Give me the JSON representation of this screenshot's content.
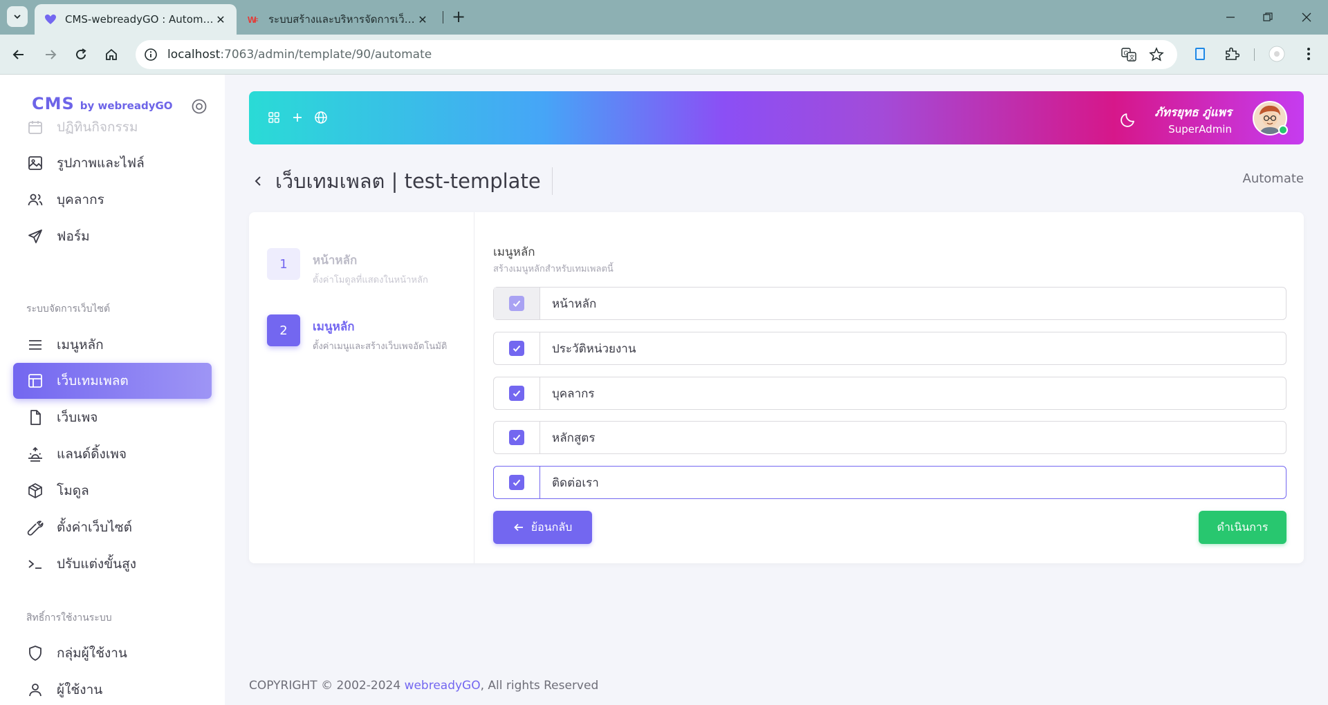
{
  "browser": {
    "tabs": [
      {
        "title": "CMS-webreadyGO : Automate",
        "active": true,
        "favicon": "heart-icon"
      },
      {
        "title": "ระบบสร้างและบริหารจัดการเว็บไซต์",
        "active": false,
        "favicon": "wf-logo-icon"
      }
    ],
    "url_host": "localhost",
    "url_path": ":7063/admin/template/90/automate"
  },
  "brand": {
    "name": "CMS",
    "by": "by webreadyGO"
  },
  "sidebar": {
    "top_items": [
      {
        "label": "ปฏิทินกิจกรรม",
        "icon": "calendar-icon"
      },
      {
        "label": "รูปภาพและไฟล์",
        "icon": "image-icon"
      },
      {
        "label": "บุคลากร",
        "icon": "users-icon"
      },
      {
        "label": "ฟอร์ม",
        "icon": "send-icon"
      }
    ],
    "section_site": "ระบบจัดการเว็บไซต์",
    "site_items": [
      {
        "label": "เมนูหลัก",
        "icon": "menu-icon"
      },
      {
        "label": "เว็บเทมเพลต",
        "icon": "layout-icon"
      },
      {
        "label": "เว็บเพจ",
        "icon": "file-icon"
      },
      {
        "label": "แลนด์ดิ้งเพจ",
        "icon": "sunrise-icon"
      },
      {
        "label": "โมดูล",
        "icon": "box-icon"
      },
      {
        "label": "ตั้งค่าเว็บไซต์",
        "icon": "wrench-icon"
      },
      {
        "label": "ปรับแต่งขั้นสูง",
        "icon": "terminal-icon"
      }
    ],
    "section_access": "สิทธิ์การใช้งานระบบ",
    "access_items": [
      {
        "label": "กลุ่มผู้ใช้งาน",
        "icon": "shield-icon"
      },
      {
        "label": "ผู้ใช้งาน",
        "icon": "user-icon"
      }
    ]
  },
  "header": {
    "user_name": "ภัทรยุทธ ภู่แพร",
    "user_role": "SuperAdmin"
  },
  "page": {
    "title": "เว็บเทมเพลต | test-template",
    "breadcrumb": "Automate"
  },
  "steps": [
    {
      "number": "1",
      "title": "หน้าหลัก",
      "subtitle": "ตั้งค่าโมดูลที่แสดงในหน้าหลัก",
      "state": "done"
    },
    {
      "number": "2",
      "title": "เมนูหลัก",
      "subtitle": "ตั้งค่าเมนูและสร้างเว็บเพจอัตโนมัติ",
      "state": "current"
    }
  ],
  "form": {
    "title": "เมนูหลัก",
    "subtitle": "สร้างเมนูหลักสำหรับเทมเพลตนี้",
    "items": [
      {
        "value": "หน้าหลัก",
        "checked": true,
        "disabled": true
      },
      {
        "value": "ประวัติหน่วยงาน",
        "checked": true,
        "disabled": false
      },
      {
        "value": "บุคลากร",
        "checked": true,
        "disabled": false
      },
      {
        "value": "หลักสูตร",
        "checked": true,
        "disabled": false
      },
      {
        "value": "ติดต่อเรา",
        "checked": true,
        "disabled": false
      }
    ],
    "back_label": "ย้อนกลับ",
    "submit_label": "ดำเนินการ"
  },
  "footer": {
    "prefix": "COPYRIGHT © 2002-2024 ",
    "link": "webreadyGO",
    "suffix": ", All rights Reserved"
  },
  "colors": {
    "primary": "#7367f0",
    "success": "#28c76f",
    "tab_bar": "#8db0b3"
  }
}
